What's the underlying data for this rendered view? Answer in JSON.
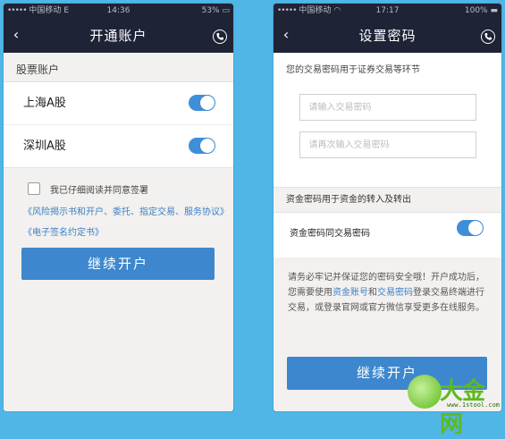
{
  "left_screen": {
    "status": {
      "carrier": "中国移动",
      "network": "E",
      "time": "14:36",
      "battery": "53%"
    },
    "nav": {
      "back_icon": "back-chevron",
      "title": "开通账户",
      "phone_icon": "phone-icon"
    },
    "section_title": "股票账户",
    "accounts": [
      {
        "label": "上海A股",
        "enabled": true
      },
      {
        "label": "深圳A股",
        "enabled": true
      }
    ],
    "agreement_text": "我已仔细阅读并同意签署",
    "links": [
      "《风险揭示书和开户、委托、指定交易、服务协议》",
      "《电子签名约定书》"
    ],
    "continue_button": "继续开户"
  },
  "right_screen": {
    "status": {
      "carrier": "中国移动",
      "network": "",
      "time": "17:17",
      "battery": "100%"
    },
    "nav": {
      "back_icon": "back-chevron",
      "title": "设置密码",
      "phone_icon": "phone-icon"
    },
    "trade_password_hint": "您的交易密码用于证券交易等环节",
    "trade_password_placeholder": "请输入交易密码",
    "trade_password_confirm_placeholder": "请再次输入交易密码",
    "fund_password_hint": "资金密码用于资金的转入及转出",
    "same_as_trade_label": "资金密码同交易密码",
    "same_as_trade_enabled": true,
    "note_part1": "请务必牢记并保证您的密码安全哦！开户成功后，您需要使用",
    "note_link1": "资金账号",
    "note_part2": "和",
    "note_link2": "交易密码",
    "note_part3": "登录交易终端进行交易，或登录官网或官方微信享受更多在线服务。",
    "continue_button": "继续开户"
  },
  "watermark": {
    "brand": "大金网",
    "url": "www.1stool.com"
  },
  "colors": {
    "navbar": "#1f2336",
    "accent": "#3d87cf",
    "link": "#3f7fc6",
    "background": "#4fb6e6"
  }
}
